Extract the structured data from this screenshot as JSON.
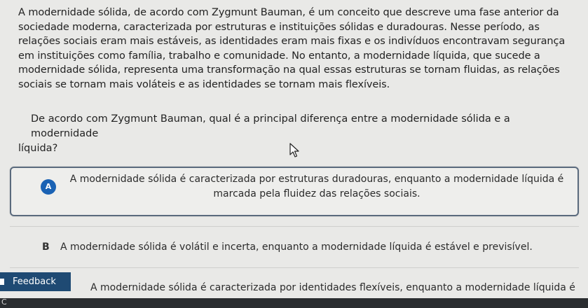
{
  "passage": {
    "lines": [
      "A modernidade sólida, de acordo com Zygmunt Bauman, é um conceito que descreve uma fase anterior da",
      "sociedade moderna, caracterizada por estruturas e instituições sólidas e duradouras. Nesse período, as",
      "relações sociais eram mais estáveis, as identidades eram mais fixas e os indivíduos encontravam segurança",
      "em instituições como família, trabalho e comunidade. No entanto, a modernidade líquida, que sucede a",
      "modernidade sólida, representa uma transformação na qual essas estruturas se tornam fluidas, as relações",
      "sociais se tornam mais voláteis e as identidades se tornam mais flexíveis."
    ]
  },
  "question": {
    "line1": "De acordo com Zygmunt Bauman, qual é a principal diferença entre a modernidade sólida e a modernidade",
    "line2": "líquida?"
  },
  "options": [
    {
      "letter": "A",
      "line1": "A modernidade sólida é caracterizada por estruturas duradouras, enquanto a modernidade líquida é",
      "line2": "marcada pela fluidez das relações sociais.",
      "selected": true
    },
    {
      "letter": "B",
      "text": "A modernidade sólida é volátil e incerta, enquanto a modernidade líquida é estável e previsível.",
      "selected": false
    },
    {
      "letter": "C",
      "text": "A modernidade sólida é caracterizada por identidades flexíveis, enquanto a modernidade líquida é",
      "selected": false
    }
  ],
  "feedback": {
    "label": "Feedback"
  },
  "colors": {
    "accent": "#1a62b4",
    "feedback_bg": "#1f4a73",
    "selected_border": "#5a6a7d"
  },
  "icons": {
    "cursor": "arrow-cursor-icon",
    "feedback": "feedback-icon"
  },
  "bottom_bar": {
    "glyph": "C"
  }
}
